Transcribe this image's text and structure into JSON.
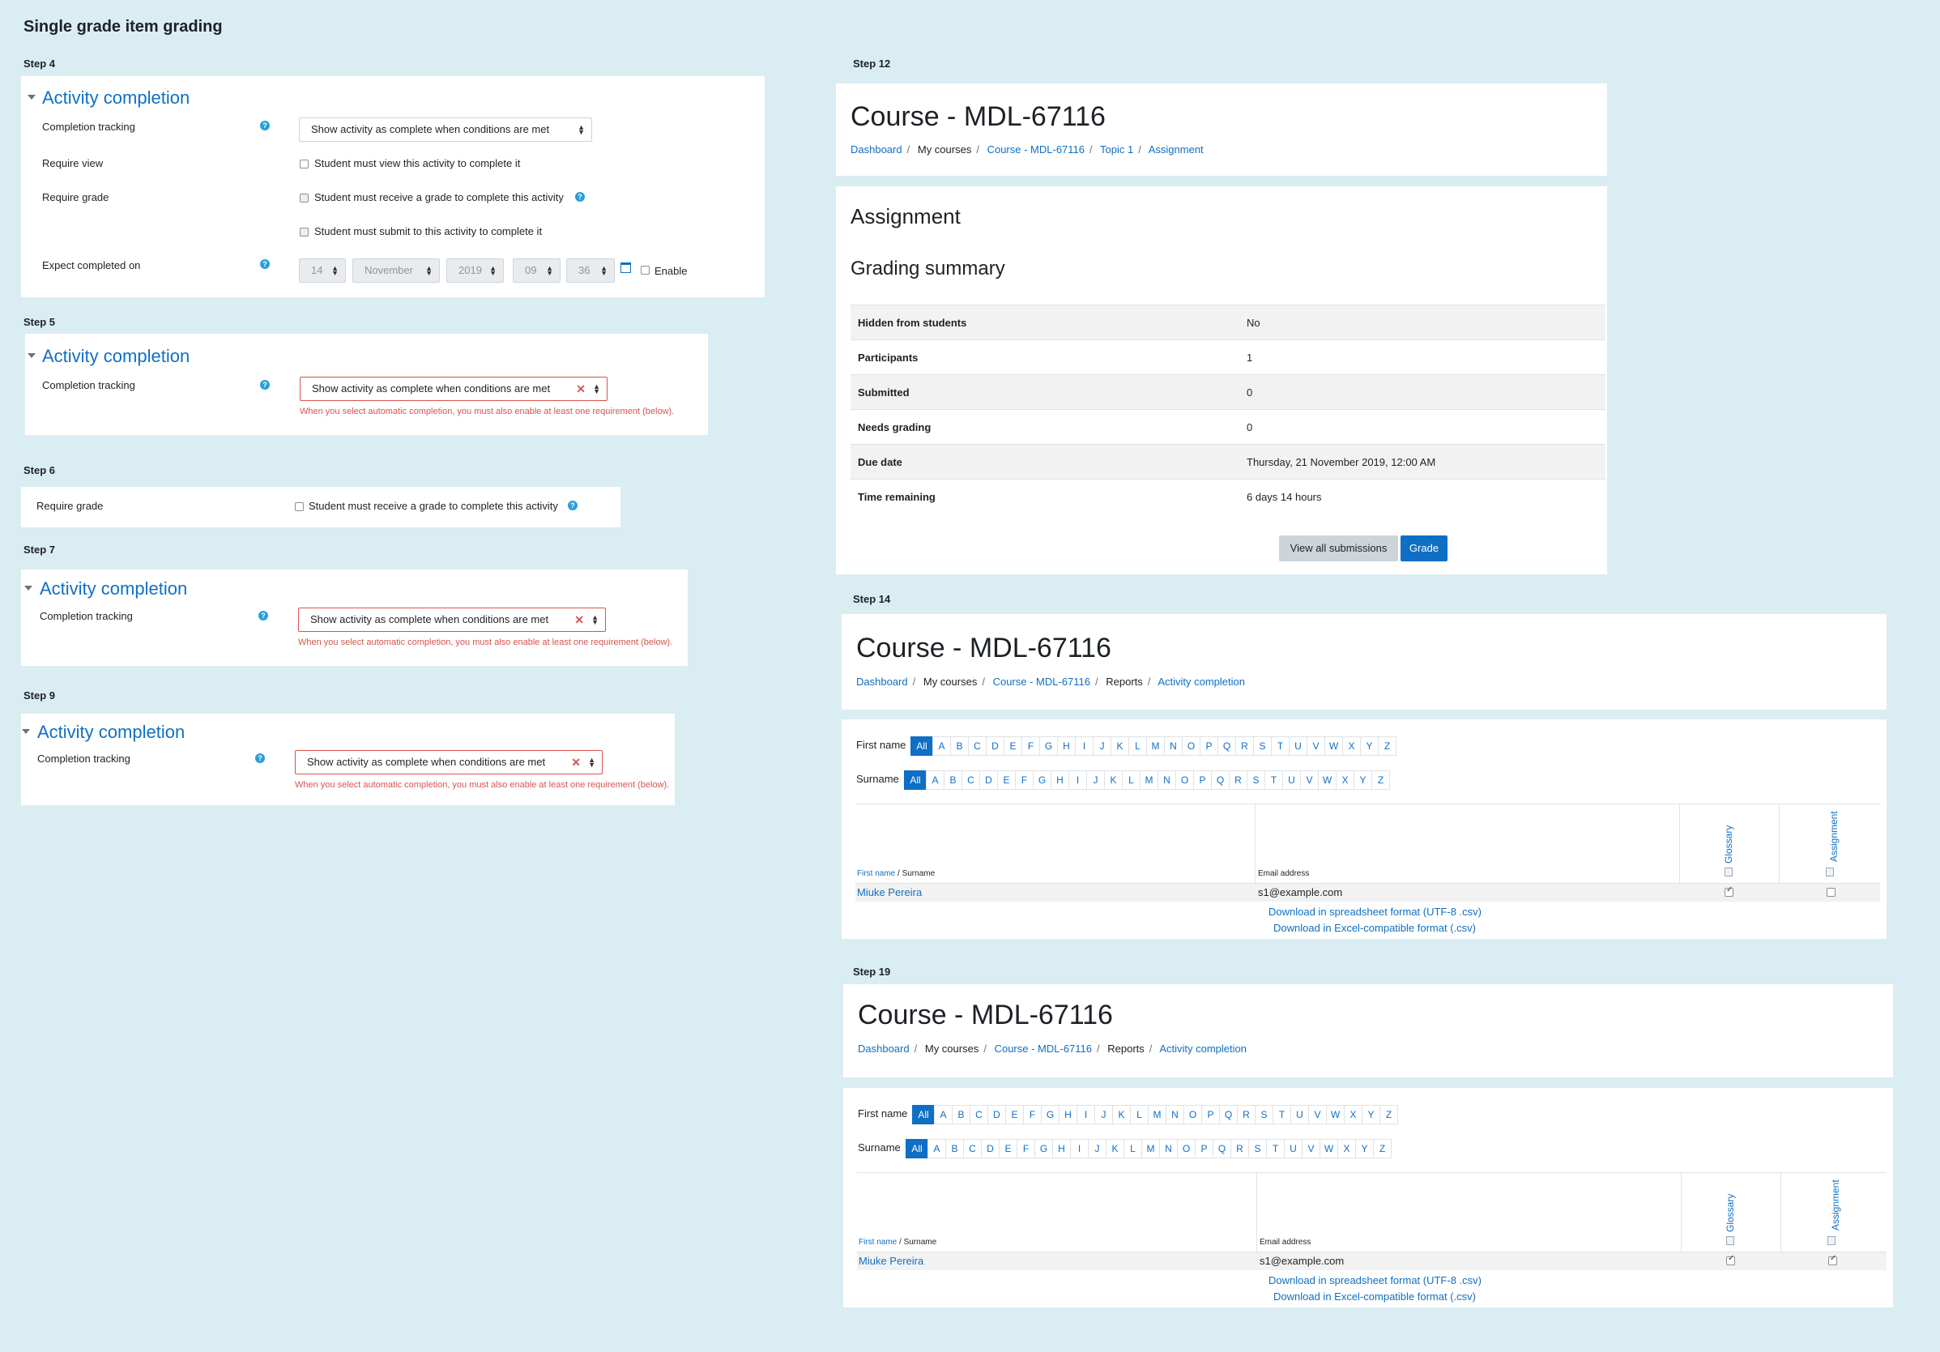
{
  "title": "Single grade item grading",
  "step4": {
    "label": "Step 4",
    "section": "Activity completion",
    "completion_tracking": "Completion tracking",
    "select_value": "Show activity as complete when conditions are met",
    "require_view": "Require view",
    "require_view_check": "Student must view this activity to complete it",
    "require_grade": "Require grade",
    "require_grade_check": "Student must receive a grade to complete this activity",
    "require_submit_check": "Student must submit to this activity to complete it",
    "expect_completed": "Expect completed on",
    "day": "14",
    "month": "November",
    "year": "2019",
    "hour": "09",
    "minute": "36",
    "enable": "Enable"
  },
  "step5": {
    "label": "Step 5",
    "section": "Activity completion",
    "completion_tracking": "Completion tracking",
    "select_value": "Show activity as complete when conditions are met",
    "error": "When you select automatic completion, you must also enable at least one requirement (below)."
  },
  "step6": {
    "label": "Step 6",
    "require_grade": "Require grade",
    "require_grade_check": "Student must receive a grade to complete this activity"
  },
  "step7": {
    "label": "Step 7",
    "section": "Activity completion",
    "completion_tracking": "Completion tracking",
    "select_value": "Show activity as complete when conditions are met",
    "error": "When you select automatic completion, you must also enable at least one requirement (below)."
  },
  "step9": {
    "label": "Step 9",
    "section": "Activity completion",
    "completion_tracking": "Completion tracking",
    "select_value": "Show activity as complete when conditions are met",
    "error": "When you select automatic completion, you must also enable at least one requirement (below)."
  },
  "step12": {
    "label": "Step 12",
    "course_title": "Course - MDL-67116",
    "breadcrumb": [
      "Dashboard",
      "My courses",
      "Course - MDL-67116",
      "Topic 1",
      "Assignment"
    ],
    "heading": "Assignment",
    "summary_heading": "Grading summary",
    "rows": [
      {
        "k": "Hidden from students",
        "v": "No"
      },
      {
        "k": "Participants",
        "v": "1"
      },
      {
        "k": "Submitted",
        "v": "0"
      },
      {
        "k": "Needs grading",
        "v": "0"
      },
      {
        "k": "Due date",
        "v": "Thursday, 21 November 2019, 12:00 AM"
      },
      {
        "k": "Time remaining",
        "v": "6 days 14 hours"
      }
    ],
    "view_all": "View all submissions",
    "grade": "Grade"
  },
  "report_common": {
    "letters": [
      "All",
      "A",
      "B",
      "C",
      "D",
      "E",
      "F",
      "G",
      "H",
      "I",
      "J",
      "K",
      "L",
      "M",
      "N",
      "O",
      "P",
      "Q",
      "R",
      "S",
      "T",
      "U",
      "V",
      "W",
      "X",
      "Y",
      "Z"
    ],
    "first_name_label": "First name",
    "surname_label": "Surname",
    "col_first": "First name",
    "col_sep": " / ",
    "col_surname": "Surname",
    "col_email": "Email address",
    "col_glossary": "Glossary",
    "col_assignment": "Assignment",
    "student_name": "Miuke Pereira",
    "student_email": "s1@example.com",
    "dl_csv": "Download in spreadsheet format (UTF-8 .csv)",
    "dl_excel": "Download in Excel-compatible format (.csv)"
  },
  "step14": {
    "label": "Step 14",
    "course_title": "Course - MDL-67116",
    "breadcrumb": [
      "Dashboard",
      "My courses",
      "Course - MDL-67116",
      "Reports",
      "Activity completion"
    ],
    "glossary_done": true,
    "assignment_done": false
  },
  "step19": {
    "label": "Step 19",
    "course_title": "Course - MDL-67116",
    "breadcrumb": [
      "Dashboard",
      "My courses",
      "Course - MDL-67116",
      "Reports",
      "Activity completion"
    ],
    "glossary_done": true,
    "assignment_done": true
  }
}
